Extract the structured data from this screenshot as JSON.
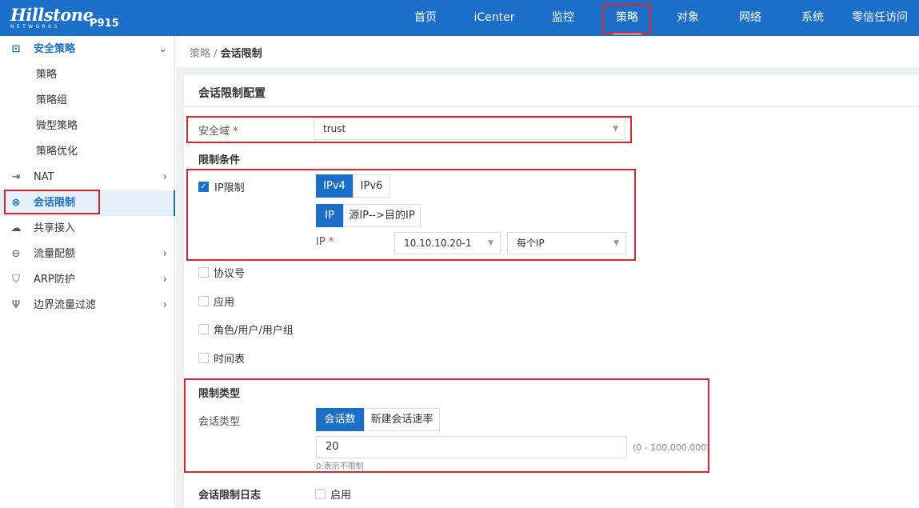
{
  "header": {
    "brand": "Hillstone",
    "brand_sub": "NETWORKS",
    "model": "P915",
    "nav": [
      "首页",
      "iCenter",
      "监控",
      "策略",
      "对象",
      "网络",
      "系统",
      "零信任访问"
    ],
    "active_nav": "策略"
  },
  "sidebar": {
    "items": [
      {
        "label": "安全策略",
        "icon": "policy-icon"
      },
      {
        "label": "策略"
      },
      {
        "label": "策略组"
      },
      {
        "label": "微型策略"
      },
      {
        "label": "策略优化"
      },
      {
        "label": "NAT",
        "icon": "nat-icon"
      },
      {
        "label": "会话限制",
        "icon": "session-limit-icon"
      },
      {
        "label": "共享接入",
        "icon": "shared-access-icon"
      },
      {
        "label": "流量配额",
        "icon": "quota-icon"
      },
      {
        "label": "ARP防护",
        "icon": "arp-icon"
      },
      {
        "label": "边界流量过滤",
        "icon": "filter-icon"
      }
    ]
  },
  "breadcrumb": {
    "parent": "策略 / ",
    "current": "会话限制"
  },
  "form": {
    "title": "会话限制配置",
    "zone_label": "安全域",
    "zone_required": "*",
    "zone_value": "trust",
    "cond_title": "限制条件",
    "ip_limit_label": "IP限制",
    "ipv4": "IPv4",
    "ipv6": "IPv6",
    "ip_mode_ip": "IP",
    "ip_mode_src_dst": "源IP-->目的IP",
    "ip_label": "IP",
    "ip_required": "*",
    "ip_value": "10.10.10.20-1",
    "ip_scope": "每个IP",
    "protocol_label": "协议号",
    "app_label": "应用",
    "role_label": "角色/用户/用户组",
    "schedule_label": "时间表",
    "type_title": "限制类型",
    "session_type_label": "会话类型",
    "type_sessions": "会话数",
    "type_rate": "新建会话速率",
    "count_value": "20",
    "range_hint": "(0 - 100,000,000)",
    "zero_hint": "0:表示不限制",
    "log_label": "会话限制日志",
    "log_enable": "启用"
  },
  "colors": {
    "primary": "#1c6fc8",
    "highlight_box": "#e0262b"
  }
}
